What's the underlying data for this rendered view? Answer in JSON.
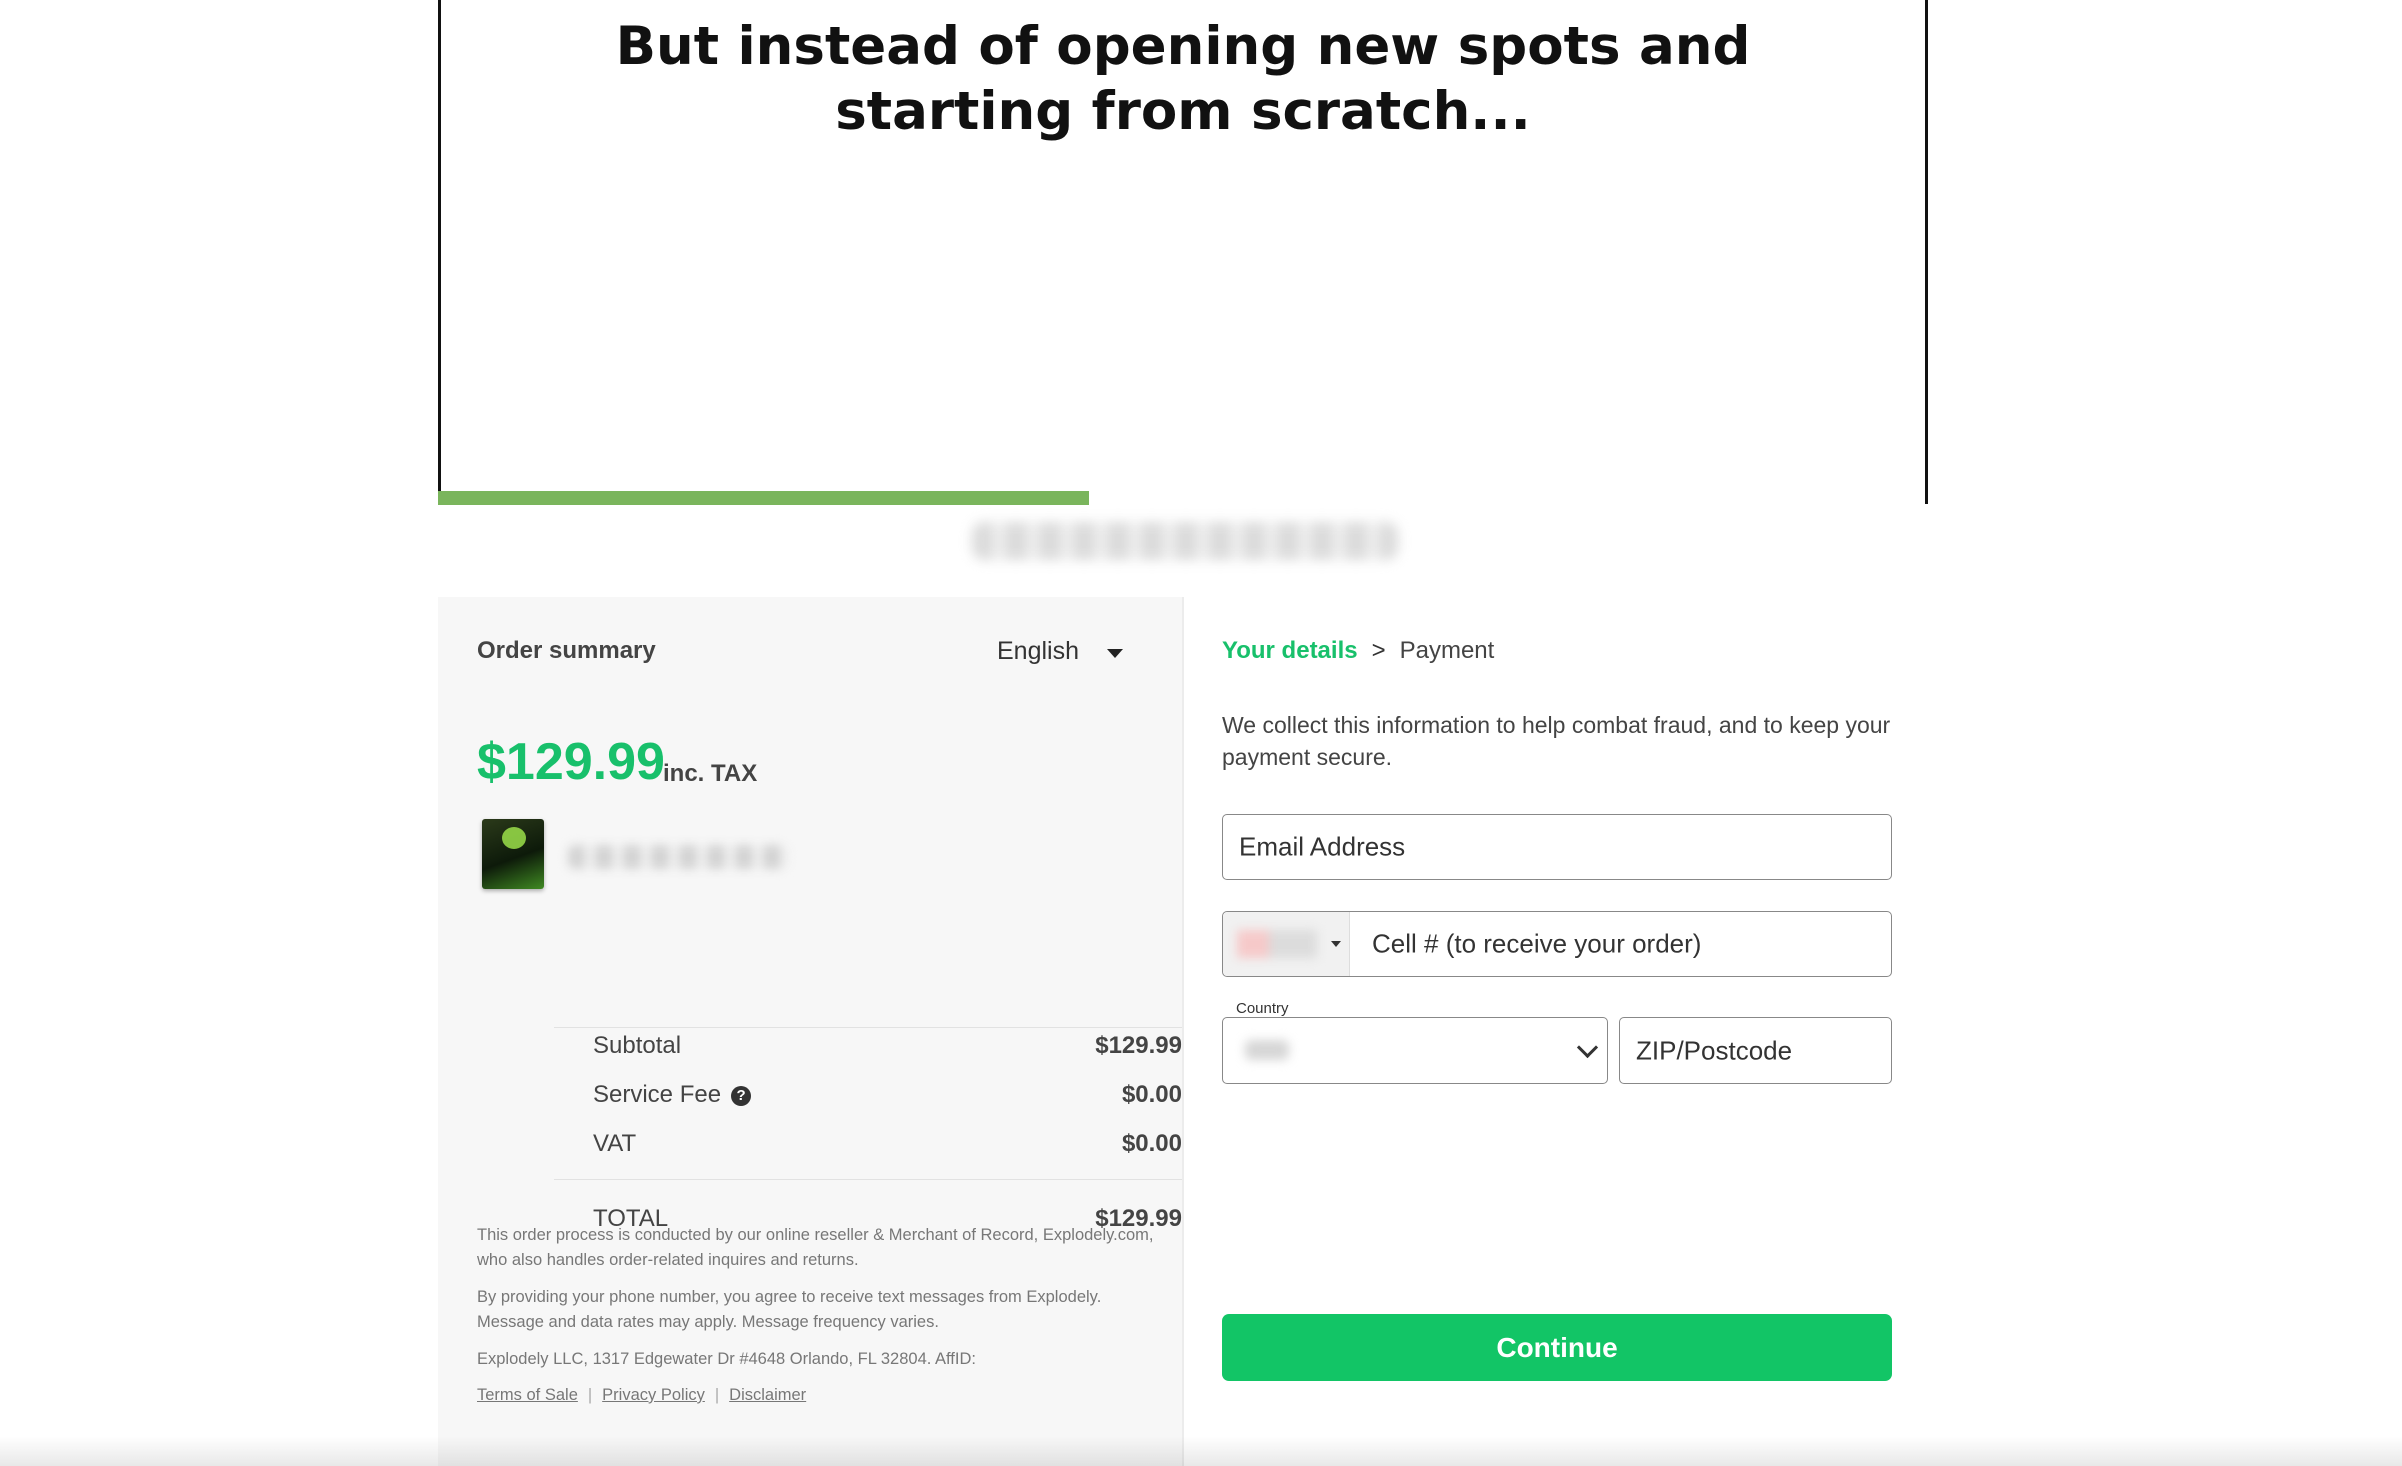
{
  "video": {
    "caption": "But instead of opening new spots and\nstarting from scratch...",
    "progress_percent": 43.7,
    "progress_color": "#7ab55c"
  },
  "summary": {
    "title": "Order summary",
    "language": "English",
    "price": "$129.99",
    "price_suffix": "inc. TAX",
    "rows": {
      "subtotal_label": "Subtotal",
      "subtotal_value": "$129.99",
      "service_fee_label": "Service Fee",
      "service_fee_value": "$0.00",
      "vat_label": "VAT",
      "vat_value": "$0.00",
      "total_label": "TOTAL",
      "total_value": "$129.99"
    },
    "legal": [
      "This order process is conducted by our online reseller & Merchant of Record, Explodely.com, who also handles order-related inquires and returns.",
      "By providing your phone number, you agree to receive text messages from Explodely. Message and data rates may apply. Message frequency varies.",
      "Explodely LLC, 1317 Edgewater Dr #4648 Orlando, FL 32804. AffID:"
    ],
    "links": {
      "terms": "Terms of Sale",
      "privacy": "Privacy Policy",
      "disclaimer": "Disclaimer",
      "separator": "|"
    }
  },
  "details": {
    "breadcrumb_active": "Your details",
    "breadcrumb_separator": ">",
    "breadcrumb_next": "Payment",
    "info": "We collect this information to help combat fraud, and to keep your payment secure.",
    "email_placeholder": "Email Address",
    "phone_placeholder": "Cell # (to receive your order)",
    "country_label": "Country",
    "zip_placeholder": "ZIP/Postcode",
    "continue_label": "Continue"
  },
  "colors": {
    "accent_green": "#18c06b",
    "button_green": "#12c566",
    "panel_bg": "#f7f7f7"
  }
}
